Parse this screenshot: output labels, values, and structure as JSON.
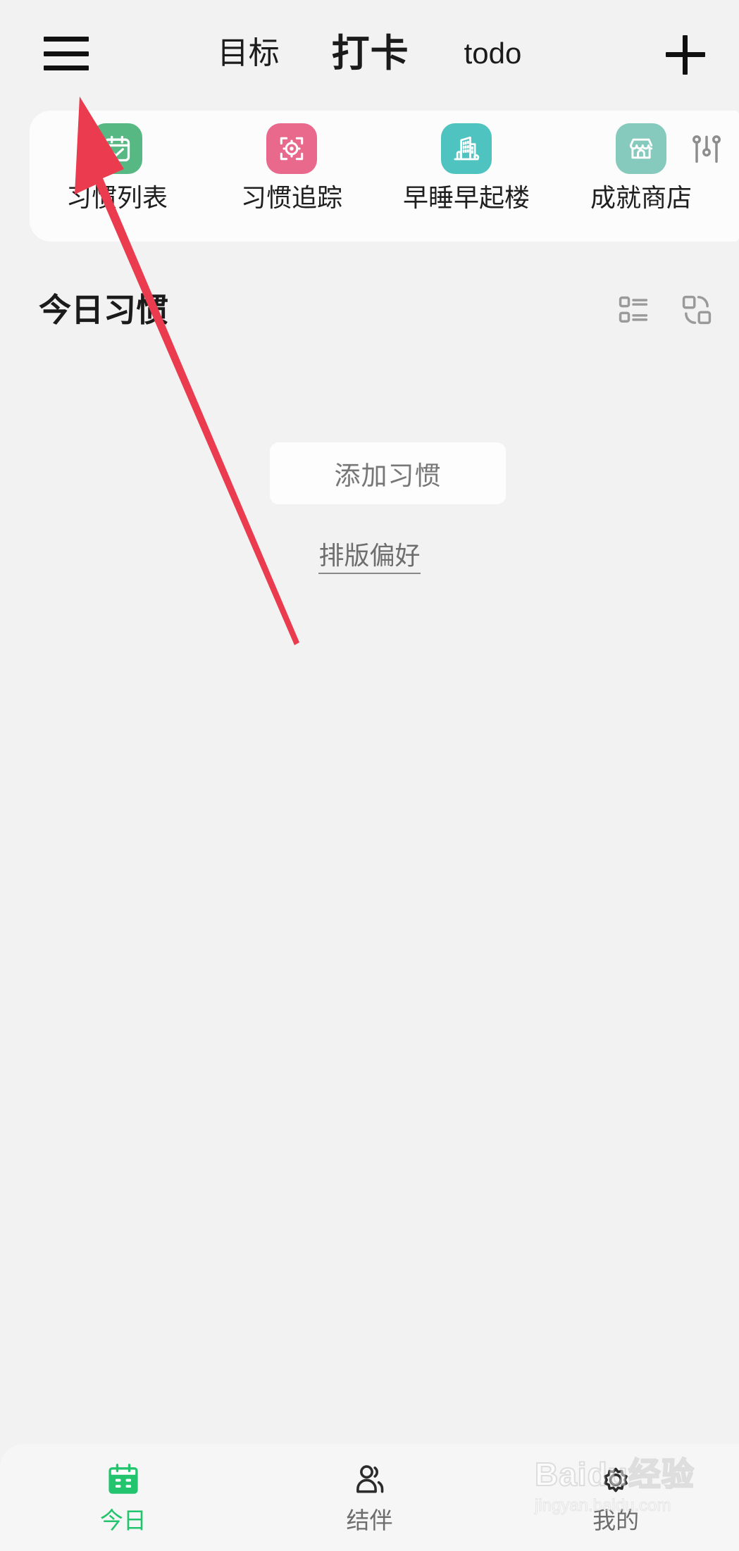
{
  "header": {
    "menu_icon": "hamburger-menu-icon",
    "tabs": [
      {
        "label": "目标",
        "active": false
      },
      {
        "label": "打卡",
        "active": true
      },
      {
        "label": "todo",
        "active": false
      }
    ],
    "add_icon": "plus-icon"
  },
  "shortcuts": {
    "settings_icon": "sliders-icon",
    "items": [
      {
        "label": "习惯列表",
        "icon": "calendar-check-icon",
        "color": "#57b883"
      },
      {
        "label": "习惯追踪",
        "icon": "target-focus-icon",
        "color": "#e8698c"
      },
      {
        "label": "早睡早起楼",
        "icon": "buildings-icon",
        "color": "#4ec3c0"
      },
      {
        "label": "成就商店",
        "icon": "shop-icon",
        "color": "#86c9bd"
      }
    ]
  },
  "section": {
    "title": "今日习惯",
    "actions": [
      {
        "name": "list-view-icon"
      },
      {
        "name": "swap-view-icon"
      }
    ]
  },
  "empty_state": {
    "add_button_label": "添加习惯",
    "preference_link_label": "排版偏好"
  },
  "annotation": {
    "arrow_color": "#ea3b4f",
    "points_to": "hamburger-menu-icon"
  },
  "bottom_nav": {
    "active_color": "#22c56e",
    "items": [
      {
        "label": "今日",
        "icon": "calendar-icon",
        "active": true
      },
      {
        "label": "结伴",
        "icon": "people-icon",
        "active": false
      },
      {
        "label": "我的",
        "icon": "gear-icon",
        "active": false
      }
    ]
  },
  "watermark": {
    "main": "Baidu经验",
    "sub": "jingyan.baidu.com"
  }
}
